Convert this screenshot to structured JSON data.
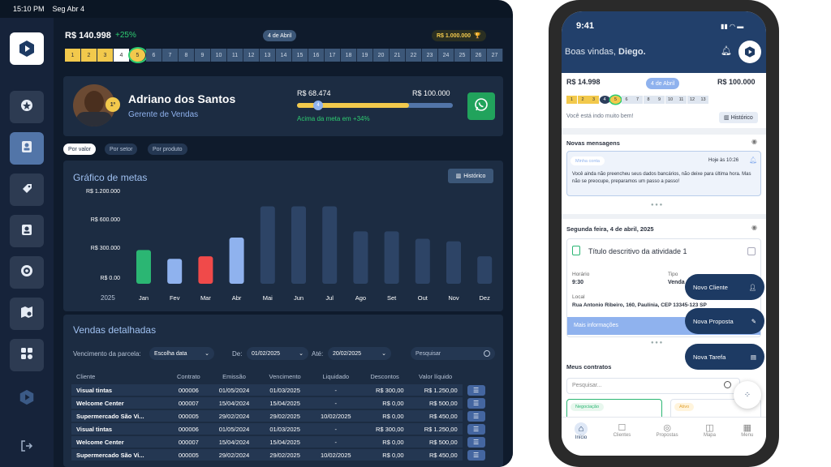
{
  "status": {
    "time": "15:10 PM",
    "date": "Seg Abr 4"
  },
  "top": {
    "amount": "R$ 140.998",
    "growth": "+25%",
    "date": "4 de Abril",
    "goal": "R$ 1.000.000"
  },
  "levels": [
    "1",
    "2",
    "3",
    "4",
    "5",
    "6",
    "7",
    "8",
    "9",
    "10",
    "11",
    "12",
    "13",
    "14",
    "15",
    "16",
    "17",
    "18",
    "19",
    "20",
    "21",
    "22",
    "23",
    "24",
    "25",
    "26",
    "27"
  ],
  "profile": {
    "name": "Adriano dos Santos",
    "role": "Gerente de Vendas",
    "rank": "1º",
    "current": "R$ 68.474",
    "target": "R$ 100.000",
    "marker": "4",
    "note": "Acima da meta em +34%",
    "progress": 0.72
  },
  "filters": [
    "Por valor",
    "Por setor",
    "Por produto"
  ],
  "chart_data": {
    "type": "bar",
    "title": "Gráfico de metas",
    "button": "Histórico",
    "year": "2025",
    "categories": [
      "Jan",
      "Fev",
      "Mar",
      "Abr",
      "Mai",
      "Jun",
      "Jul",
      "Ago",
      "Set",
      "Out",
      "Nov",
      "Dez"
    ],
    "yticks": [
      "R$ 1.200.000",
      "R$ 600.000",
      "R$ 300.000",
      "R$ 0.00"
    ],
    "values": [
      0.27,
      0.2,
      0.22,
      0.37,
      0.62,
      0.62,
      0.62,
      0.42,
      0.42,
      0.36,
      0.34,
      0.22
    ],
    "colors": [
      "#2bb673",
      "#8fb2ee",
      "#f04a4a",
      "#8fb2ee",
      "#2d4466",
      "#2d4466",
      "#2d4466",
      "#2d4466",
      "#2d4466",
      "#2d4466",
      "#2d4466",
      "#2d4466"
    ]
  },
  "sales": {
    "title": "Vendas detalhadas",
    "parcel_label": "Vencimento da parcela:",
    "parcel_value": "Escolha data",
    "de_label": "De:",
    "de_value": "01/02/2025",
    "ate_label": "Até:",
    "ate_value": "20/02/2025",
    "search": "Pesquisar",
    "headers": [
      "Cliente",
      "Contrato",
      "Emissão",
      "Vencimento",
      "Liquidado",
      "Descontos",
      "Valor líquido"
    ],
    "rows": [
      [
        "Visual tintas",
        "000006",
        "01/05/2024",
        "01/03/2025",
        "-",
        "R$ 300,00",
        "R$ 1.250,00"
      ],
      [
        "Welcome Center",
        "000007",
        "15/04/2024",
        "15/04/2025",
        "-",
        "R$ 0,00",
        "R$ 500,00"
      ],
      [
        "Supermercado São Vi...",
        "000005",
        "29/02/2024",
        "29/02/2025",
        "10/02/2025",
        "R$ 0,00",
        "R$ 450,00"
      ],
      [
        "Visual tintas",
        "000006",
        "01/05/2024",
        "01/03/2025",
        "-",
        "R$ 300,00",
        "R$ 1.250,00"
      ],
      [
        "Welcome Center",
        "000007",
        "15/04/2024",
        "15/04/2025",
        "-",
        "R$ 0,00",
        "R$ 500,00"
      ],
      [
        "Supermercado São Vi...",
        "000005",
        "29/02/2024",
        "29/02/2025",
        "10/02/2025",
        "R$ 0,00",
        "R$ 450,00"
      ]
    ]
  },
  "phone": {
    "time": "9:41",
    "welcome": "Boas vindas, ",
    "user": "Diego.",
    "amount": "R$ 14.998",
    "date": "4 de Abril",
    "goal": "R$ 100.000",
    "levels": [
      "1",
      "2",
      "3",
      "4",
      "5",
      "6",
      "7",
      "8",
      "9",
      "10",
      "11",
      "12",
      "13"
    ],
    "doing": "Você está indo muito bem!",
    "history": "Histórico",
    "messages_title": "Novas mensagens",
    "msg_tag": "Minha conta",
    "msg_time": "Hoje às 10:26",
    "msg_text": "Você ainda não preencheu seus dados bancários, não deixe para última hora. Mas não se preocupe, preparamos um passo a passo!",
    "day": "Segunda feira, 4 de abril, 2025",
    "activity": "Título descritivo da atividade 1",
    "horario_label": "Horário",
    "horario": "9:30",
    "tipo_label": "Tipo",
    "tipo": "Venda",
    "local_label": "Local",
    "local": "Rua Antonio Ribeiro, 160, Paulínia, CEP 13345-123 SP",
    "more": "Mais informações",
    "fabs": [
      "Novo Cliente",
      "Nova Proposta",
      "Nova Tarefa"
    ],
    "contracts": "Meus contratos",
    "search": "Pesquisar...",
    "tag1": "Negociação",
    "tag2": "Ativo",
    "nav": [
      "Início",
      "Clientes",
      "Propostas",
      "Mapa",
      "Menu"
    ]
  }
}
